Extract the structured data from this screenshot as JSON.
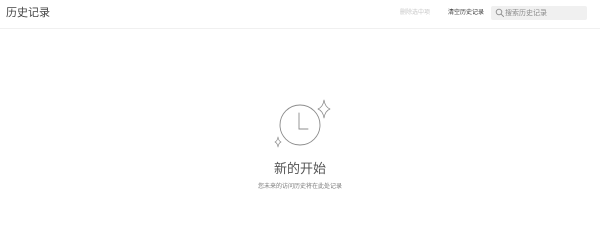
{
  "header": {
    "title": "历史记录",
    "delete_selected_label": "删除选中项",
    "clear_history_label": "清空历史记录",
    "search": {
      "placeholder": "搜索历史记录",
      "value": "",
      "icon": "search-icon"
    }
  },
  "empty_state": {
    "icon": "clock-sparkle-icon",
    "title": "新的开始",
    "subtitle": "您未来的访问历史将在此处记录"
  },
  "colors": {
    "background": "#ffffff",
    "search_background": "#f0f0f0",
    "disabled_text": "#c8c8c8",
    "primary_text": "#333333",
    "icon_stroke": "#8c8c8c"
  }
}
